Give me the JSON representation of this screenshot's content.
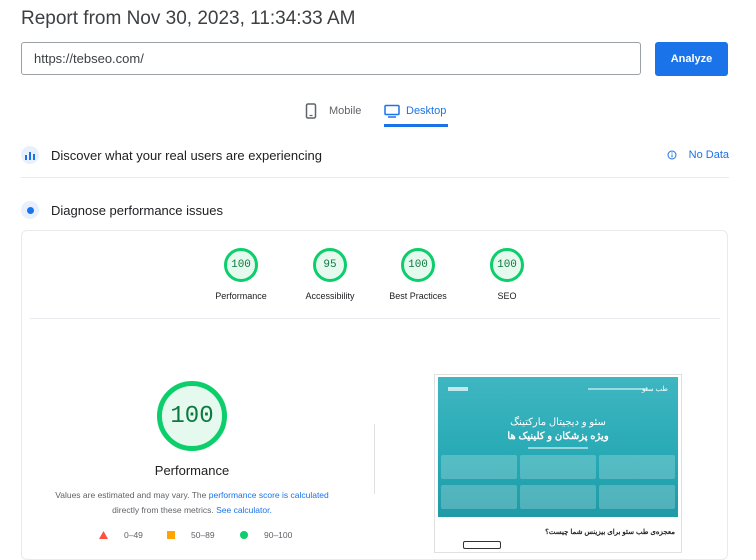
{
  "header": {
    "report_title": "Report from Nov 30, 2023, 11:34:33 AM",
    "url_value": "https://tebseo.com/",
    "analyze_label": "Analyze"
  },
  "tabs": [
    {
      "label": "Mobile",
      "icon": "phone-icon",
      "active": false
    },
    {
      "label": "Desktop",
      "icon": "monitor-icon",
      "active": true
    }
  ],
  "field_data": {
    "heading": "Discover what your real users are experiencing",
    "status": "No Data",
    "icon": "users-chart-icon",
    "status_icon": "info-icon"
  },
  "diagnose": {
    "heading": "Diagnose performance issues",
    "icon": "lab-pulse-icon"
  },
  "scores": [
    {
      "label": "Performance",
      "value": "100"
    },
    {
      "label": "Accessibility",
      "value": "95"
    },
    {
      "label": "Best Practices",
      "value": "100"
    },
    {
      "label": "SEO",
      "value": "100"
    }
  ],
  "performance": {
    "score": "100",
    "label": "Performance",
    "note_prefix": "Values are estimated and may vary. The ",
    "note_link1": "performance score is calculated",
    "note_middle": "directly from these metrics. ",
    "note_link2": "See calculator."
  },
  "legend": [
    {
      "range": "0–49",
      "shape": "triangle",
      "color": "#ff4e42"
    },
    {
      "range": "50–89",
      "shape": "square",
      "color": "#ffa400"
    },
    {
      "range": "90–100",
      "shape": "circle",
      "color": "#0cce6b"
    }
  ],
  "screenshot": {
    "headline1": "سئو و دیجیتال مارکتینگ",
    "headline2": "ویژه پزشکان و کلینیک ها",
    "footer_text": "معجزه‌ی طب سئو برای بیزینس شما چیست؟",
    "logo_text": "طب سئو"
  },
  "colors": {
    "accent": "#1a73e8",
    "pass": "#0cce6b",
    "teal": "#26a9b4"
  }
}
